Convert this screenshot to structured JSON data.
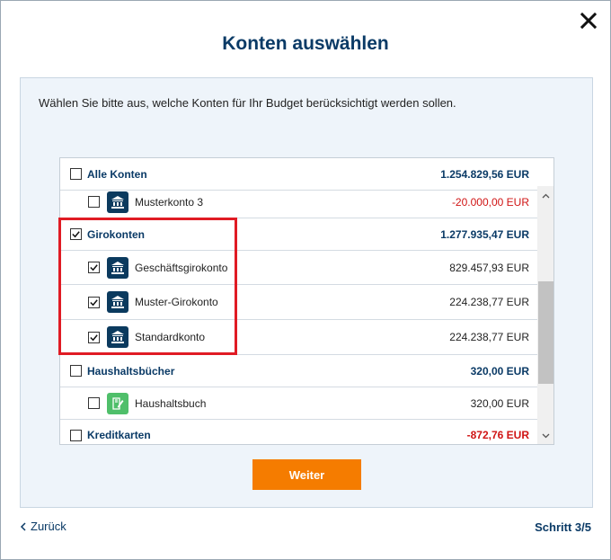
{
  "dialog": {
    "title": "Konten auswählen",
    "intro": "Wählen Sie bitte aus, welche Konten für Ihr Budget berücksichtigt werden sollen."
  },
  "accounts": {
    "all": {
      "label": "Alle Konten",
      "amount": "1.254.829,56 EUR",
      "checked": false
    },
    "musterkonto3": {
      "label": "Musterkonto 3",
      "amount": "-20.000,00 EUR",
      "checked": false,
      "icon": "bank-icon"
    },
    "girokonten": {
      "label": "Girokonten",
      "amount": "1.277.935,47 EUR",
      "checked": true
    },
    "geschaeftsgirokonto": {
      "label": "Geschäftsgirokonto",
      "amount": "829.457,93 EUR",
      "checked": true,
      "icon": "bank-icon"
    },
    "mustergirokonto": {
      "label": "Muster-Girokonto",
      "amount": "224.238,77 EUR",
      "checked": true,
      "icon": "bank-icon"
    },
    "standardkonto": {
      "label": "Standardkonto",
      "amount": "224.238,77 EUR",
      "checked": true,
      "icon": "bank-icon"
    },
    "haushaltsbuecher": {
      "label": "Haushaltsbücher",
      "amount": "320,00 EUR",
      "checked": false
    },
    "haushaltsbuch": {
      "label": "Haushaltsbuch",
      "amount": "320,00 EUR",
      "checked": false,
      "icon": "notebook-icon"
    },
    "kreditkarten": {
      "label": "Kreditkarten",
      "amount": "-872,76 EUR",
      "checked": false
    }
  },
  "buttons": {
    "weiter": "Weiter",
    "zurueck": "Zurück"
  },
  "footer": {
    "step": "Schritt 3/5"
  },
  "colors": {
    "accent": "#f57c00",
    "title": "#0a3a66",
    "negative": "#d01414",
    "highlight": "#e01b24",
    "bankIcon": "#0b3a5e",
    "notebookIcon": "#4fbf6a"
  }
}
